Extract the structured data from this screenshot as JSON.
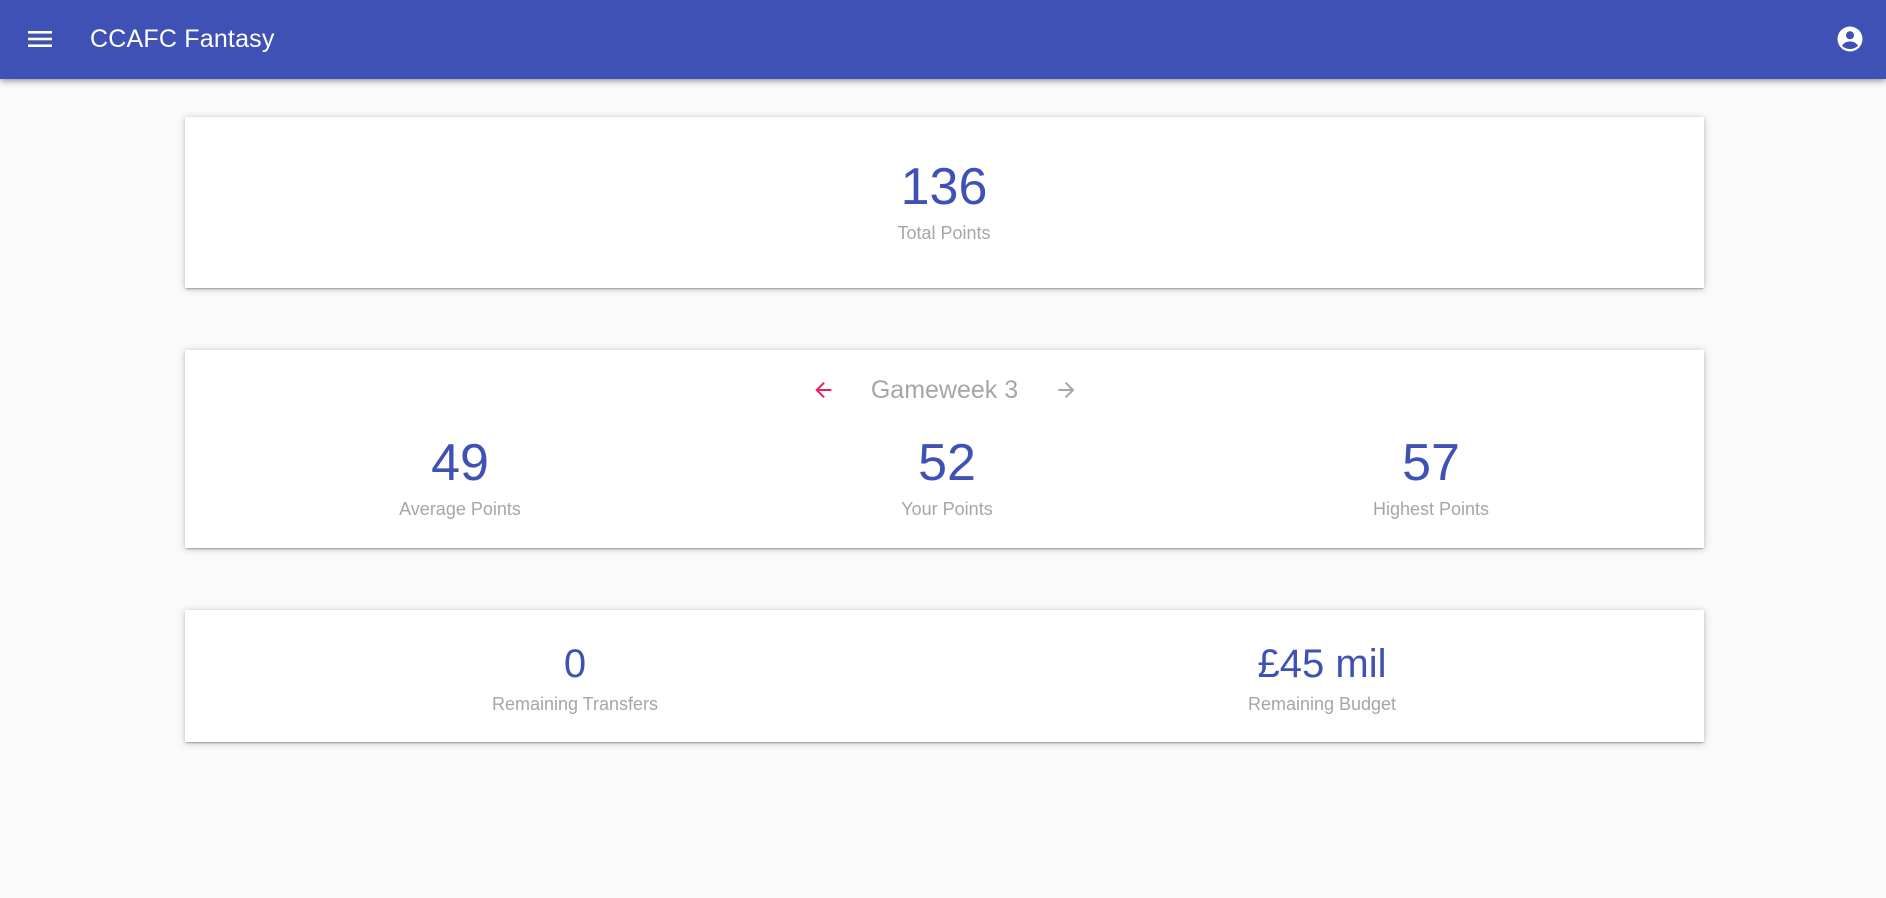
{
  "appbar": {
    "title": "CCAFC Fantasy",
    "menu_icon": "menu-icon",
    "account_icon": "account-circle-icon",
    "color": "#3f51b5"
  },
  "total_card": {
    "value": "136",
    "label": "Total Points"
  },
  "gameweek_card": {
    "title": "Gameweek 3",
    "prev_icon": "arrow-left-icon",
    "next_icon": "arrow-right-icon",
    "prev_color": "#e91e63",
    "next_color": "#a6a6a6",
    "stats": [
      {
        "value": "49",
        "label": "Average Points"
      },
      {
        "value": "52",
        "label": "Your Points"
      },
      {
        "value": "57",
        "label": "Highest Points"
      }
    ]
  },
  "transfers_card": {
    "stats": [
      {
        "value": "0",
        "label": "Remaining Transfers"
      },
      {
        "value": "£45 mil",
        "label": "Remaining Budget"
      }
    ]
  },
  "colors": {
    "accent": "#3f51b5",
    "muted_text": "#a6a6a6",
    "background": "#fafafa"
  }
}
